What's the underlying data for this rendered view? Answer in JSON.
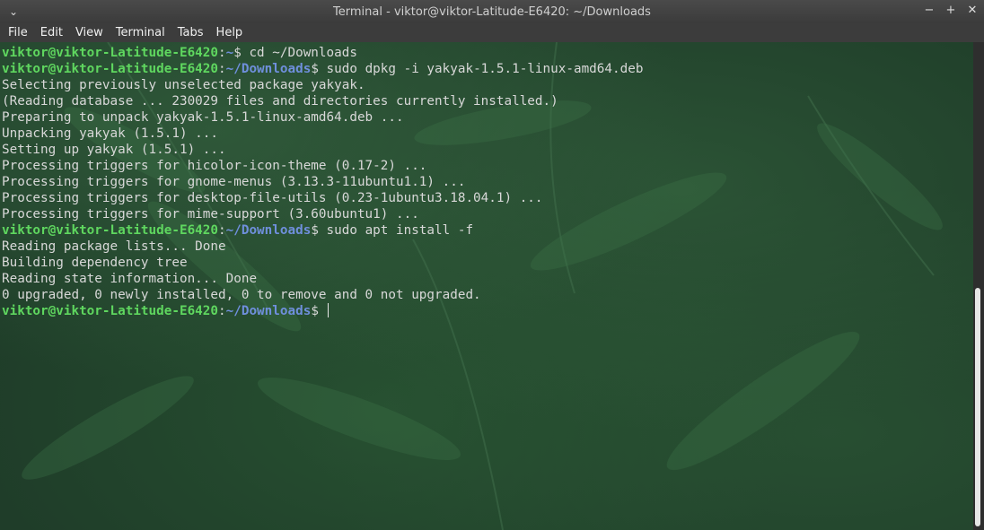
{
  "window": {
    "title": "Terminal - viktor@viktor-Latitude-E6420: ~/Downloads",
    "menu_icon": "chevron-down-icon",
    "controls": [
      {
        "name": "minimize",
        "glyph": "−"
      },
      {
        "name": "maximize",
        "glyph": "+"
      },
      {
        "name": "close",
        "glyph": "✕"
      }
    ]
  },
  "menu": [
    "File",
    "Edit",
    "View",
    "Terminal",
    "Tabs",
    "Help"
  ],
  "colors": {
    "prompt_user": "#5fd75f",
    "prompt_path": "#6f8fdc",
    "output_text": "#d8d8d8"
  },
  "terminal": {
    "lines": [
      {
        "type": "prompt",
        "user": "viktor@viktor-Latitude-E6420",
        "sep": ":",
        "path": "~",
        "symbol": "$",
        "cmd": " cd ~/Downloads"
      },
      {
        "type": "prompt",
        "user": "viktor@viktor-Latitude-E6420",
        "sep": ":",
        "path": "~/Downloads",
        "symbol": "$",
        "cmd": " sudo dpkg -i yakyak-1.5.1-linux-amd64.deb"
      },
      {
        "type": "output",
        "text": "Selecting previously unselected package yakyak."
      },
      {
        "type": "output",
        "text": "(Reading database ... 230029 files and directories currently installed.)"
      },
      {
        "type": "output",
        "text": "Preparing to unpack yakyak-1.5.1-linux-amd64.deb ..."
      },
      {
        "type": "output",
        "text": "Unpacking yakyak (1.5.1) ..."
      },
      {
        "type": "output",
        "text": "Setting up yakyak (1.5.1) ..."
      },
      {
        "type": "output",
        "text": "Processing triggers for hicolor-icon-theme (0.17-2) ..."
      },
      {
        "type": "output",
        "text": "Processing triggers for gnome-menus (3.13.3-11ubuntu1.1) ..."
      },
      {
        "type": "output",
        "text": "Processing triggers for desktop-file-utils (0.23-1ubuntu3.18.04.1) ..."
      },
      {
        "type": "output",
        "text": "Processing triggers for mime-support (3.60ubuntu1) ..."
      },
      {
        "type": "prompt",
        "user": "viktor@viktor-Latitude-E6420",
        "sep": ":",
        "path": "~/Downloads",
        "symbol": "$",
        "cmd": " sudo apt install -f"
      },
      {
        "type": "output",
        "text": "Reading package lists... Done"
      },
      {
        "type": "output",
        "text": "Building dependency tree"
      },
      {
        "type": "output",
        "text": "Reading state information... Done"
      },
      {
        "type": "output",
        "text": "0 upgraded, 0 newly installed, 0 to remove and 0 not upgraded."
      },
      {
        "type": "prompt",
        "user": "viktor@viktor-Latitude-E6420",
        "sep": ":",
        "path": "~/Downloads",
        "symbol": "$",
        "cmd": " ",
        "cursor": true
      }
    ]
  },
  "scrollbar": {
    "position_fraction": 0.5,
    "visible_fraction": 0.49
  }
}
